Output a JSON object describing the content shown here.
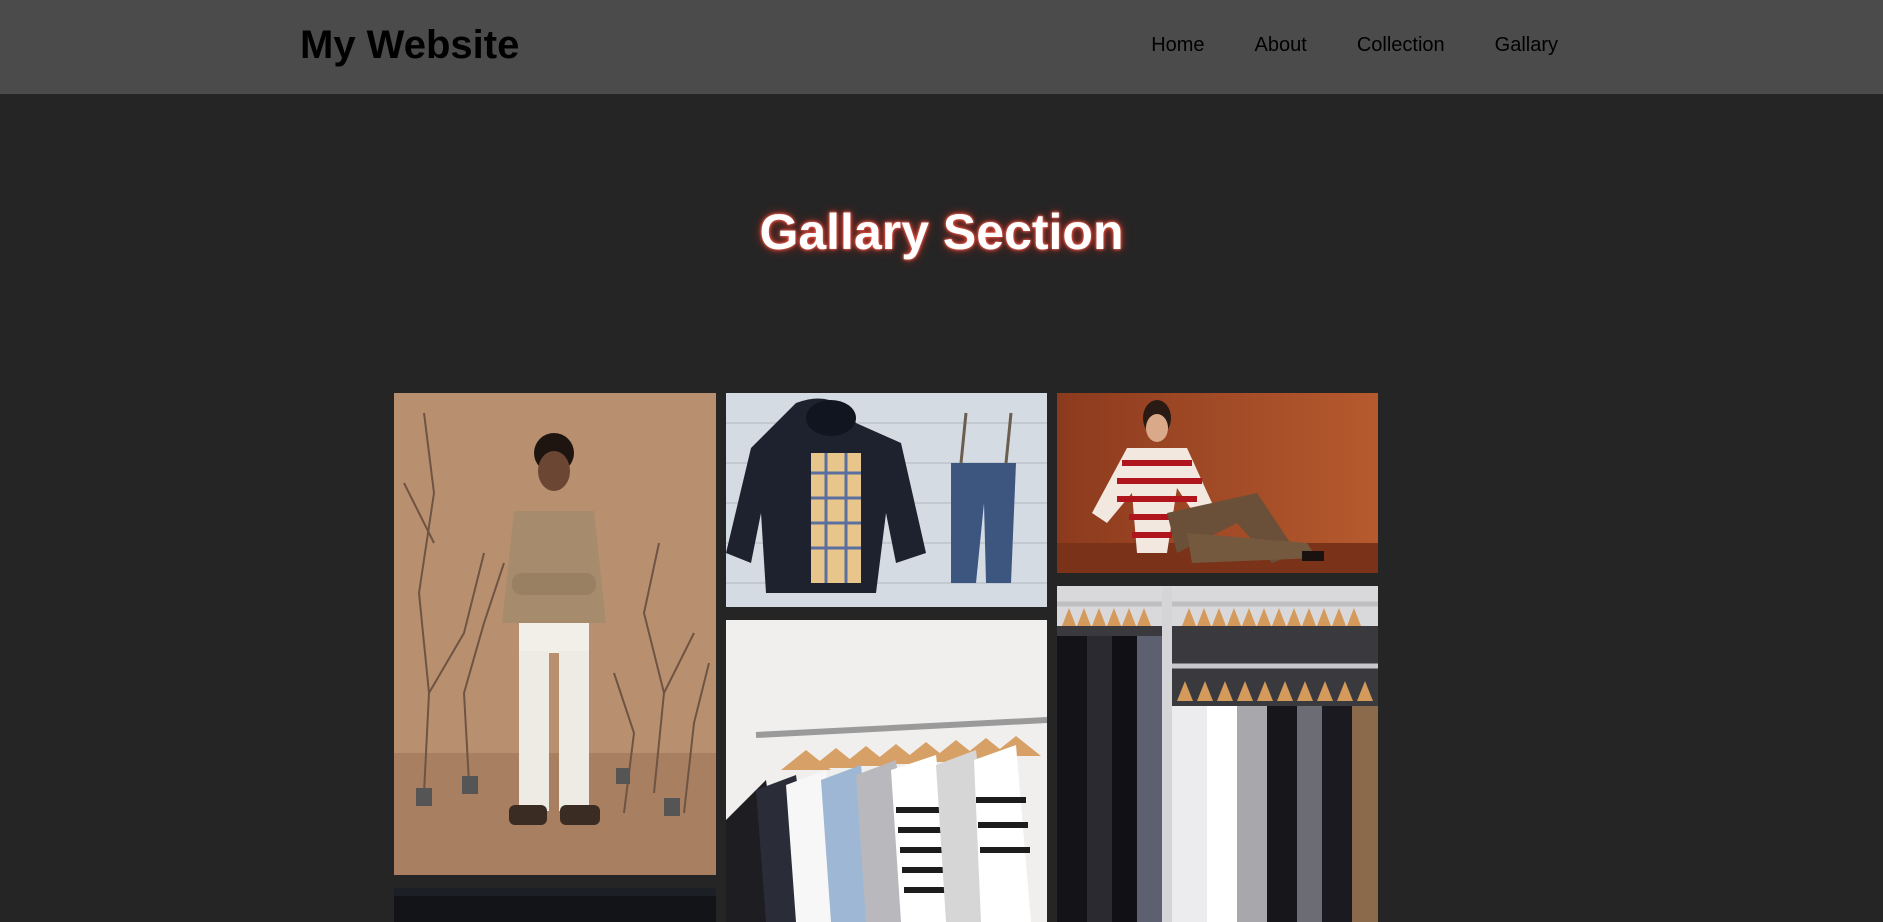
{
  "header": {
    "brand": "My Website",
    "nav": [
      {
        "label": "Home"
      },
      {
        "label": "About"
      },
      {
        "label": "Collection"
      },
      {
        "label": "Gallary"
      }
    ]
  },
  "gallery": {
    "title": "Gallary Section",
    "images": [
      {
        "name": "man-in-sweater-photo"
      },
      {
        "name": "kids-clothes-flatlay-photo"
      },
      {
        "name": "woman-striped-sweater-photo"
      },
      {
        "name": "clothes-rack-hangers-photo"
      },
      {
        "name": "clothing-store-racks-photo"
      },
      {
        "name": "dark-partial-photo"
      }
    ]
  },
  "colors": {
    "page_background": "#252525",
    "navbar_background": "#4b4b4b",
    "title_glow": "#ff5a4a"
  }
}
